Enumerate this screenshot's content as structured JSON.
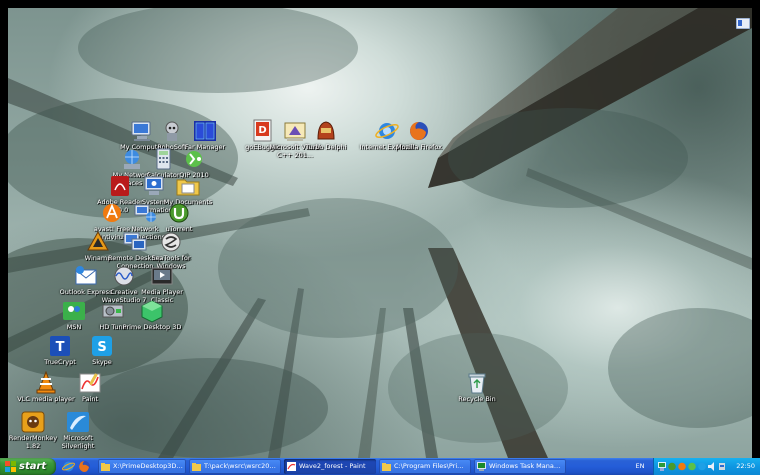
{
  "desktop": {
    "icons": [
      {
        "label": "My Computer",
        "icon": "computer-icon"
      },
      {
        "label": "RoboSoft",
        "icon": "robosoft-icon"
      },
      {
        "label": "Far Manager",
        "icon": "far-manager-icon"
      },
      {
        "label": "goEBugger",
        "icon": "debugger-icon"
      },
      {
        "label": "Microsoft Visual C++ 201...",
        "icon": "visual-cpp-icon"
      },
      {
        "label": "Turbo Delphi",
        "icon": "delphi-icon"
      },
      {
        "label": "Internet Explorer",
        "icon": "internet-explorer-icon"
      },
      {
        "label": "Mozilla Firefox",
        "icon": "firefox-icon"
      },
      {
        "label": "My Network Places",
        "icon": "network-places-icon"
      },
      {
        "label": "Calculator",
        "icon": "calculator-icon"
      },
      {
        "label": "QIP 2010",
        "icon": "qip-icon"
      },
      {
        "label": "Adobe Reader 8.0.0",
        "icon": "adobe-reader-icon"
      },
      {
        "label": "System Information",
        "icon": "system-information-icon"
      },
      {
        "label": "My Documents",
        "icon": "my-documents-icon"
      },
      {
        "label": "avast! Free Antivirus",
        "icon": "avast-icon"
      },
      {
        "label": "Network Connections",
        "icon": "network-connections-icon"
      },
      {
        "label": "uTorrent",
        "icon": "utorrent-icon"
      },
      {
        "label": "Winamp",
        "icon": "winamp-icon"
      },
      {
        "label": "Remote Desktop Connection",
        "icon": "remote-desktop-icon"
      },
      {
        "label": "SeaTools for Windows",
        "icon": "seatools-icon"
      },
      {
        "label": "Outlook Express",
        "icon": "outlook-express-icon"
      },
      {
        "label": "Creative WaveStudio 7",
        "icon": "wavestudio-icon"
      },
      {
        "label": "Media Player Classic",
        "icon": "media-player-classic-icon"
      },
      {
        "label": "MSN",
        "icon": "msn-icon"
      },
      {
        "label": "HD Tune",
        "icon": "hd-tune-icon"
      },
      {
        "label": "Prime Desktop 3D",
        "icon": "prime-desktop-icon"
      },
      {
        "label": "TrueCrypt",
        "icon": "truecrypt-icon"
      },
      {
        "label": "Skype",
        "icon": "skype-icon"
      },
      {
        "label": "VLC media player",
        "icon": "vlc-icon"
      },
      {
        "label": "Paint",
        "icon": "paint-icon"
      },
      {
        "label": "Recycle Bin",
        "icon": "recycle-bin-icon"
      },
      {
        "label": "RenderMonkey 1.82",
        "icon": "rendermonkey-icon"
      },
      {
        "label": "Microsoft Silverlight",
        "icon": "silverlight-icon"
      }
    ]
  },
  "taskbar": {
    "start_label": "start",
    "quick_launch": [
      "internet-explorer-icon",
      "firefox-icon"
    ],
    "tasks": [
      {
        "label": "X:\\PrimeDesktop3D_...",
        "active": false
      },
      {
        "label": "T:\\pack\\wsrc\\wsrc201...",
        "active": false
      },
      {
        "label": "Wave2_forest - Paint",
        "active": true
      },
      {
        "label": "C:\\Program Files\\Pri...",
        "active": false
      },
      {
        "label": "Windows Task Manager",
        "active": false
      }
    ],
    "language": "EN",
    "clock": "22:50"
  },
  "colors": {
    "taskbar_blue": "#245dd8",
    "start_green": "#3c9a3a",
    "tray_blue": "#0f97e2"
  }
}
